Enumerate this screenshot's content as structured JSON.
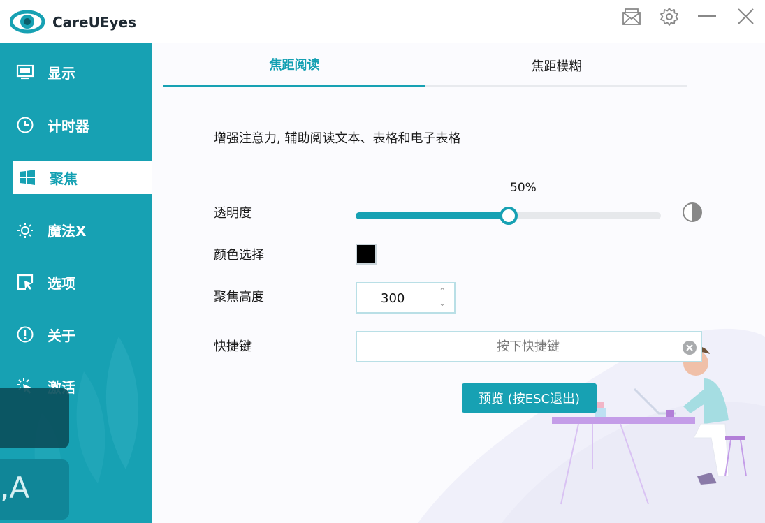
{
  "app": {
    "title": "CareUEyes"
  },
  "titlebar": {
    "icons": [
      "mail-icon",
      "gear-icon",
      "minimize-icon",
      "close-icon"
    ]
  },
  "sidebar": {
    "items": [
      {
        "label": "显示",
        "icon": "monitor-icon"
      },
      {
        "label": "计时器",
        "icon": "clock-icon"
      },
      {
        "label": "聚焦",
        "icon": "windows-icon",
        "active": true
      },
      {
        "label": "魔法X",
        "icon": "magic-sun-icon"
      },
      {
        "label": "选项",
        "icon": "cursor-box-icon"
      },
      {
        "label": "关于",
        "icon": "info-circle-icon"
      },
      {
        "label": "激活",
        "icon": "spark-cursor-icon"
      }
    ],
    "overlay_text": ",A"
  },
  "tabs": [
    {
      "label": "焦距阅读",
      "active": true
    },
    {
      "label": "焦距模糊",
      "active": false
    }
  ],
  "focus": {
    "description": "增强注意力, 辅助阅读文本、表格和电子表格",
    "opacity_label": "透明度",
    "opacity_value": 0.5,
    "opacity_text": "50%",
    "color_label": "颜色选择",
    "color_value": "#000000",
    "height_label": "聚焦高度",
    "height_value": "300",
    "hotkey_label": "快捷键",
    "hotkey_placeholder": "按下快捷键",
    "preview_button": "预览 (按ESC退出)"
  },
  "colors": {
    "accent": "#17a1b3",
    "sidebar_bg": "#17a1b3",
    "text": "#1a1a1a"
  }
}
